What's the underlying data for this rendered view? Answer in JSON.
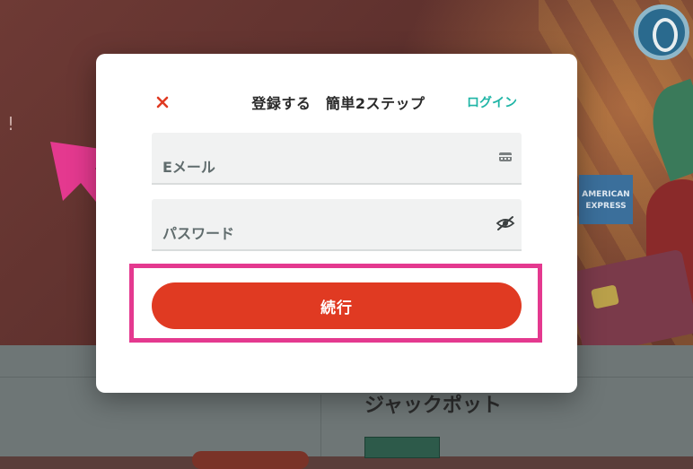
{
  "background": {
    "exclaim": "!",
    "section_heading": "ジャックポット",
    "amex_line1": "AMERICAN",
    "amex_line2": "EXPRESS"
  },
  "modal": {
    "close_icon": "close-icon",
    "title": "登録する　簡単2ステップ",
    "login_label": "ログイン",
    "email": {
      "placeholder": "Eメール",
      "value": "",
      "icon": "card-icon"
    },
    "password": {
      "placeholder": "パスワード",
      "value": "",
      "icon": "eye-off-icon"
    },
    "continue_label": "続行"
  },
  "colors": {
    "accent": "#e03a22",
    "link": "#1fb5a6",
    "highlight": "#e4398f",
    "arrow": "#e4398f"
  }
}
